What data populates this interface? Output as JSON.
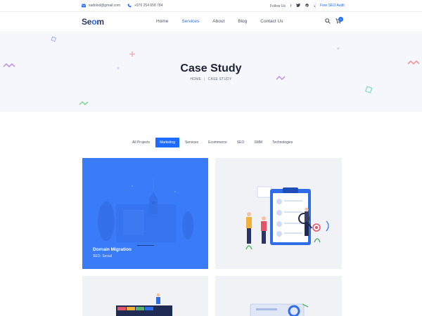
{
  "topbar": {
    "email": "sadolsd@gmail.com",
    "phone": "+976 254 658 784",
    "follow_label": "Follow Us",
    "social_icons": [
      "facebook-icon",
      "twitter-icon",
      "pinterest-icon",
      "vimeo-icon"
    ],
    "cta_label": "Free SEO Audit"
  },
  "header": {
    "logo_part1": "Se",
    "logo_accent": "o",
    "logo_part2": "m",
    "nav": [
      {
        "label": "Home",
        "active": false
      },
      {
        "label": "Services",
        "active": true
      },
      {
        "label": "About",
        "active": false
      },
      {
        "label": "Blog",
        "active": false
      },
      {
        "label": "Contact Us",
        "active": false
      }
    ],
    "cart_count": "0"
  },
  "hero": {
    "title": "Case Study",
    "breadcrumb_home": "HOME",
    "breadcrumb_sep": "|",
    "breadcrumb_current": "CASE STUDY"
  },
  "filters": [
    {
      "label": "All Projects",
      "active": false
    },
    {
      "label": "Marketing",
      "active": true
    },
    {
      "label": "Services",
      "active": false
    },
    {
      "label": "Ecommerce",
      "active": false
    },
    {
      "label": "SEO",
      "active": false
    },
    {
      "label": "SMM",
      "active": false
    },
    {
      "label": "Technologies",
      "active": false
    }
  ],
  "cards": [
    {
      "title": "Domain Migration",
      "subtitle": "SEO, Social"
    }
  ],
  "colors": {
    "accent": "#1e6bff",
    "card_highlight": "#3a7cf7",
    "hero_bg": "#f5f7fc"
  }
}
